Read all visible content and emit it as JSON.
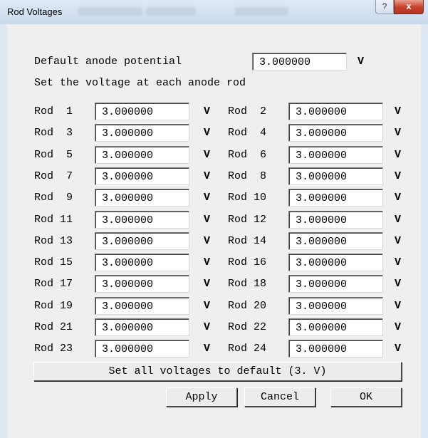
{
  "window": {
    "title": "Rod Voltages",
    "help_glyph": "?",
    "close_glyph": "x"
  },
  "default": {
    "label": "Default anode potential",
    "value": "3.000000",
    "unit": "V"
  },
  "section_label": "Set the voltage at each anode rod",
  "rods": [
    {
      "label": "Rod  1",
      "value": "3.000000",
      "unit": "V"
    },
    {
      "label": "Rod  2",
      "value": "3.000000",
      "unit": "V"
    },
    {
      "label": "Rod  3",
      "value": "3.000000",
      "unit": "V"
    },
    {
      "label": "Rod  4",
      "value": "3.000000",
      "unit": "V"
    },
    {
      "label": "Rod  5",
      "value": "3.000000",
      "unit": "V"
    },
    {
      "label": "Rod  6",
      "value": "3.000000",
      "unit": "V"
    },
    {
      "label": "Rod  7",
      "value": "3.000000",
      "unit": "V"
    },
    {
      "label": "Rod  8",
      "value": "3.000000",
      "unit": "V"
    },
    {
      "label": "Rod  9",
      "value": "3.000000",
      "unit": "V"
    },
    {
      "label": "Rod 10",
      "value": "3.000000",
      "unit": "V"
    },
    {
      "label": "Rod 11",
      "value": "3.000000",
      "unit": "V"
    },
    {
      "label": "Rod 12",
      "value": "3.000000",
      "unit": "V"
    },
    {
      "label": "Rod 13",
      "value": "3.000000",
      "unit": "V"
    },
    {
      "label": "Rod 14",
      "value": "3.000000",
      "unit": "V"
    },
    {
      "label": "Rod 15",
      "value": "3.000000",
      "unit": "V"
    },
    {
      "label": "Rod 16",
      "value": "3.000000",
      "unit": "V"
    },
    {
      "label": "Rod 17",
      "value": "3.000000",
      "unit": "V"
    },
    {
      "label": "Rod 18",
      "value": "3.000000",
      "unit": "V"
    },
    {
      "label": "Rod 19",
      "value": "3.000000",
      "unit": "V"
    },
    {
      "label": "Rod 20",
      "value": "3.000000",
      "unit": "V"
    },
    {
      "label": "Rod 21",
      "value": "3.000000",
      "unit": "V"
    },
    {
      "label": "Rod 22",
      "value": "3.000000",
      "unit": "V"
    },
    {
      "label": "Rod 23",
      "value": "3.000000",
      "unit": "V"
    },
    {
      "label": "Rod 24",
      "value": "3.000000",
      "unit": "V"
    }
  ],
  "buttons": {
    "set_default": "Set all voltages to default (3. V)",
    "apply": "Apply",
    "cancel": "Cancel",
    "ok": "OK"
  }
}
